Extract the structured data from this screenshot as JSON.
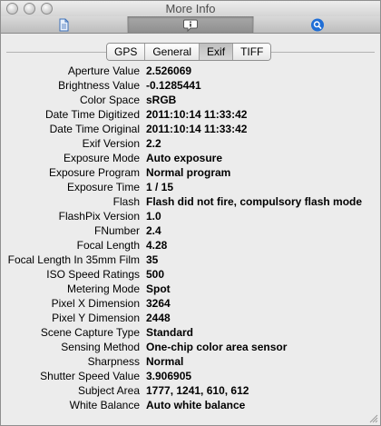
{
  "window": {
    "title": "More Info"
  },
  "toolbar": {
    "buttons": [
      {
        "name": "file-info",
        "icon": "document-icon"
      },
      {
        "name": "more-info",
        "icon": "info-bubble-icon",
        "selected": true
      },
      {
        "name": "search",
        "icon": "magnifier-icon"
      }
    ]
  },
  "tabs": [
    {
      "label": "GPS"
    },
    {
      "label": "General"
    },
    {
      "label": "Exif",
      "active": true
    },
    {
      "label": "TIFF"
    }
  ],
  "exif": [
    {
      "label": "Aperture Value",
      "value": "2.526069"
    },
    {
      "label": "Brightness Value",
      "value": "-0.1285441"
    },
    {
      "label": "Color Space",
      "value": "sRGB"
    },
    {
      "label": "Date Time Digitized",
      "value": "2011:10:14 11:33:42"
    },
    {
      "label": "Date Time Original",
      "value": "2011:10:14 11:33:42"
    },
    {
      "label": "Exif Version",
      "value": "2.2"
    },
    {
      "label": "Exposure Mode",
      "value": "Auto exposure"
    },
    {
      "label": "Exposure Program",
      "value": "Normal program"
    },
    {
      "label": "Exposure Time",
      "value": "1 / 15"
    },
    {
      "label": "Flash",
      "value": "Flash did not fire, compulsory flash mode"
    },
    {
      "label": "FlashPix Version",
      "value": "1.0"
    },
    {
      "label": "FNumber",
      "value": "2.4"
    },
    {
      "label": "Focal Length",
      "value": "4.28"
    },
    {
      "label": "Focal Length In 35mm Film",
      "value": "35"
    },
    {
      "label": "ISO Speed Ratings",
      "value": "500"
    },
    {
      "label": "Metering Mode",
      "value": "Spot"
    },
    {
      "label": "Pixel X Dimension",
      "value": "3264"
    },
    {
      "label": "Pixel Y Dimension",
      "value": "2448"
    },
    {
      "label": "Scene Capture Type",
      "value": "Standard"
    },
    {
      "label": "Sensing Method",
      "value": "One-chip color area sensor"
    },
    {
      "label": "Sharpness",
      "value": "Normal"
    },
    {
      "label": "Shutter Speed Value",
      "value": "3.906905"
    },
    {
      "label": "Subject Area",
      "value": "1777, 1241, 610, 612"
    },
    {
      "label": "White Balance",
      "value": "Auto white balance"
    }
  ]
}
